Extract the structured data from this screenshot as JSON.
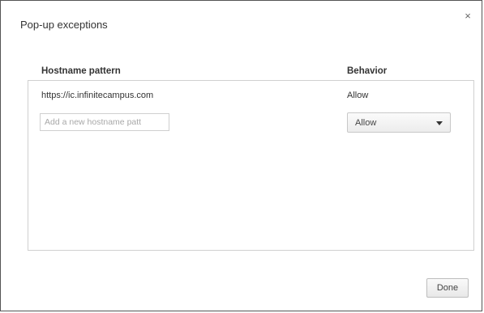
{
  "dialog": {
    "title": "Pop-up exceptions",
    "close_glyph": "×",
    "columns": {
      "hostname": "Hostname pattern",
      "behavior": "Behavior"
    },
    "exceptions": [
      {
        "hostname": "https://ic.infinitecampus.com",
        "behavior": "Allow"
      }
    ],
    "new_entry": {
      "placeholder": "Add a new hostname patt",
      "behavior_selected": "Allow"
    },
    "done_label": "Done"
  }
}
